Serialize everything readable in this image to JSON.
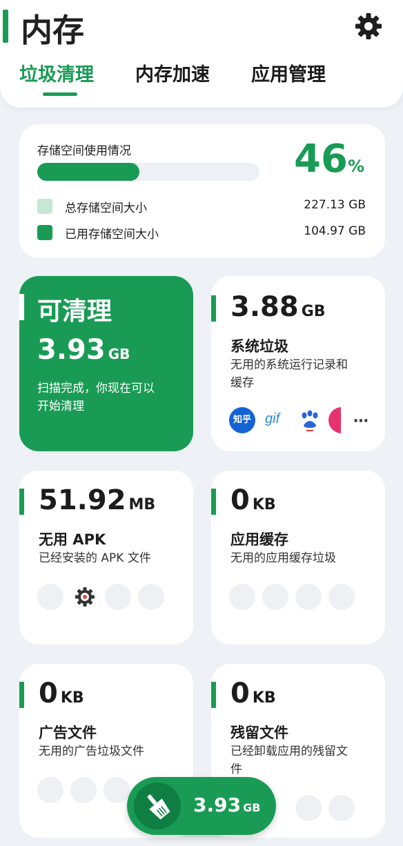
{
  "header": {
    "title": "内存",
    "tabs": [
      {
        "label": "垃圾清理",
        "active": true
      },
      {
        "label": "内存加速",
        "active": false
      },
      {
        "label": "应用管理",
        "active": false
      }
    ]
  },
  "storage": {
    "label": "存储空间使用情况",
    "percent": "46",
    "percent_unit": "%",
    "used_fraction": 0.46,
    "legend": [
      {
        "label": "总存储空间大小",
        "value": "227.13 GB",
        "color": "#c6e7d3"
      },
      {
        "label": "已用存储空间大小",
        "value": "104.97 GB",
        "color": "#1a9b55"
      }
    ]
  },
  "clean": {
    "title": "可清理",
    "size": "3.93",
    "unit": "GB",
    "desc_line1": "扫描完成，你现在可以",
    "desc_line2": "开始清理"
  },
  "cards": {
    "system": {
      "size": "3.88",
      "unit": "GB",
      "title": "系统垃圾",
      "desc_line1": "无用的系统运行记录和",
      "desc_line2": "缓存",
      "icon_names": [
        "zhihu-icon",
        "gif-icon",
        "baidu-icon",
        "app-icon",
        "more-icon"
      ],
      "zhihu_label": "知乎",
      "gif_label": "gif"
    },
    "apk": {
      "size": "51.92",
      "unit": "MB",
      "title": "无用 APK",
      "desc_line1": "已经安装的 APK 文件"
    },
    "cache": {
      "size": "0",
      "unit": "KB",
      "title": "应用缓存",
      "desc_line1": "无用的应用缓存垃圾"
    },
    "ads": {
      "size": "0",
      "unit": "KB",
      "title": "广告文件",
      "desc_line1": "无用的广告垃圾文件"
    },
    "residual": {
      "size": "0",
      "unit": "KB",
      "title": "残留文件",
      "desc_line1": "已经卸载应用的残留文",
      "desc_line2": "件"
    }
  },
  "fab": {
    "size": "3.93",
    "unit": "GB"
  },
  "colors": {
    "accent": "#1a9b55",
    "background": "#eef1f5",
    "card": "#ffffff"
  }
}
